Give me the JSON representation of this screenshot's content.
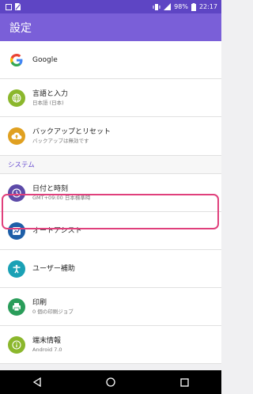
{
  "status_bar": {
    "battery": "98%",
    "time": "22:17"
  },
  "app_bar": {
    "title": "設定"
  },
  "items": [
    {
      "title": "Google",
      "subtitle": "",
      "icon": "google-icon",
      "color": "#ffffff"
    },
    {
      "title": "言語と入力",
      "subtitle": "日本語 (日本)",
      "icon": "globe-icon",
      "color": "#8bb72c"
    },
    {
      "title": "バックアップとリセット",
      "subtitle": "バックアップは無効です",
      "icon": "cloud-upload-icon",
      "color": "#e0a020"
    }
  ],
  "section": {
    "label": "システム"
  },
  "system_items": [
    {
      "title": "日付と時刻",
      "subtitle": "GMT+09:00 日本標準時",
      "icon": "clock-icon",
      "color": "#5c4aa8"
    },
    {
      "title": "オートアシスト",
      "subtitle": "",
      "icon": "auto-assist-icon",
      "color": "#1e5fa8"
    },
    {
      "title": "ユーザー補助",
      "subtitle": "",
      "icon": "accessibility-icon",
      "color": "#1aa1b5"
    },
    {
      "title": "印刷",
      "subtitle": "0 個の印刷ジョブ",
      "icon": "print-icon",
      "color": "#2a9d5a"
    },
    {
      "title": "端末情報",
      "subtitle": "Android 7.0",
      "icon": "info-icon",
      "color": "#8bb72c"
    }
  ]
}
